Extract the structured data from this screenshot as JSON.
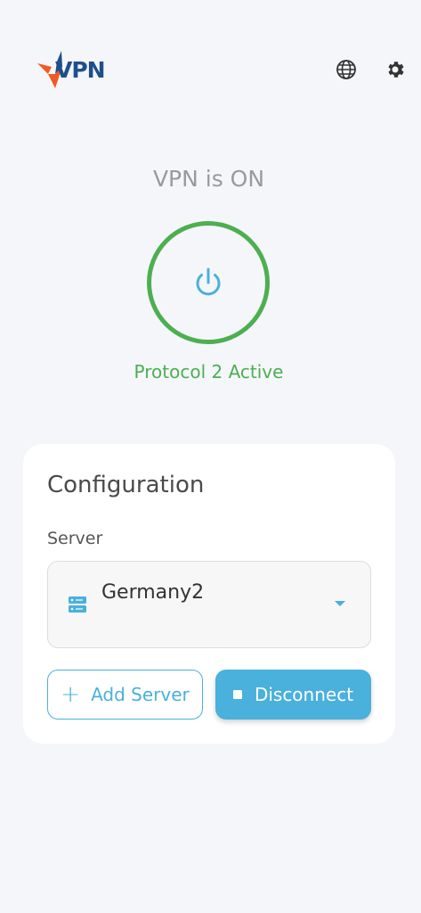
{
  "header": {
    "logo_text": "VPN",
    "language_icon": "globe-icon",
    "settings_icon": "gear-icon"
  },
  "status": {
    "title": "VPN is ON",
    "power_icon": "power-icon",
    "protocol": "Protocol 2 Active"
  },
  "config": {
    "title": "Configuration",
    "server_label": "Server",
    "server_value": "Germany2",
    "add_server_label": "Add Server",
    "disconnect_label": "Disconnect"
  },
  "colors": {
    "background": "#f5f6fa",
    "accent": "#4ab0dc",
    "active": "#4caf50",
    "logo_blue": "#1e4f8a",
    "logo_orange": "#f15a24"
  }
}
